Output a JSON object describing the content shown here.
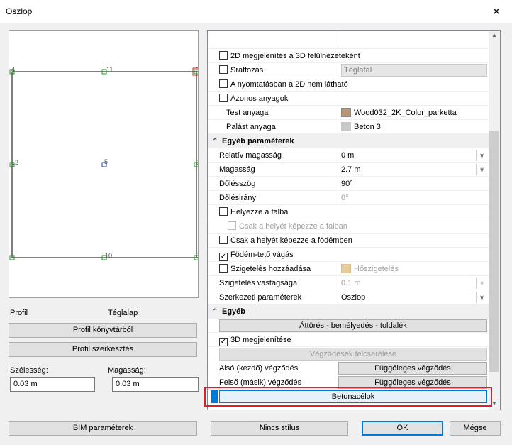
{
  "window": {
    "title": "Oszlop",
    "close": "✕"
  },
  "preview": {
    "node_labels": [
      "4",
      "11",
      "3",
      "12",
      "5",
      "2",
      "1",
      "10",
      "2"
    ]
  },
  "profile": {
    "label": "Profil",
    "value": "Téglalap",
    "library_button": "Profil könyvtárból",
    "edit_button": "Profil szerkesztés",
    "width_label": "Szélesség:",
    "width_value": "0.03 m",
    "height_label": "Magasság:",
    "height_value": "0.03 m",
    "bim_button": "BIM paraméterek"
  },
  "props": {
    "row_2d": "2D megjelenítés a 3D felülnézeteként",
    "hatch": "Sraffozás",
    "hatch_val": "Téglafal",
    "print_hidden": "A nyomtatásban a 2D nem látható",
    "same_mat": "Azonos anyagok",
    "body_mat": "Test anyaga",
    "body_mat_val": "Wood032_2K_Color_parketta",
    "shell_mat": "Palást anyaga",
    "shell_mat_val": "Beton 3",
    "cat_other_params": "Egyéb paraméterek",
    "rel_height": "Relatív magasság",
    "rel_height_val": "0 m",
    "height": "Magasság",
    "height_val": "2.7 m",
    "tilt_angle": "Dőlésszög",
    "tilt_angle_val": "90°",
    "tilt_dir": "Dőlésirány",
    "tilt_dir_val": "0°",
    "place_wall": "Helyezze a falba",
    "only_wall": "Csak a helyét képezze a falban",
    "only_slab": "Csak a helyét képezze a födémben",
    "slab_roof_cut": "Födém-tető vágás",
    "insulation_add": "Szigetelés hozzáadása",
    "insulation_val": "Hőszigetelés",
    "insulation_thk": "Szigetelés vastagsága",
    "insulation_thk_val": "0.1 m",
    "struct_param": "Szerkezeti paraméterek",
    "struct_param_val": "Oszlop",
    "cat_other": "Egyéb",
    "break_btn": "Áttörés - bemélyedés - toldalék",
    "show_3d": "3D megjelenítése",
    "swap_btn": "Végződések felcserélése",
    "bottom_end": "Alsó (kezdő) végződés",
    "bottom_end_val": "Függőleges végződés",
    "top_end": "Felső (másik) végződés",
    "top_end_val": "Függőleges végződés",
    "rebar_btn": "Betonacélok"
  },
  "footer": {
    "no_style": "Nincs stílus",
    "ok": "OK",
    "cancel": "Mégse"
  },
  "colors": {
    "highlight": "#e01e2b",
    "accent": "#0078d7",
    "wood": "#b99574",
    "concrete": "#c8c8c8",
    "insulation": "#e6cc99"
  }
}
